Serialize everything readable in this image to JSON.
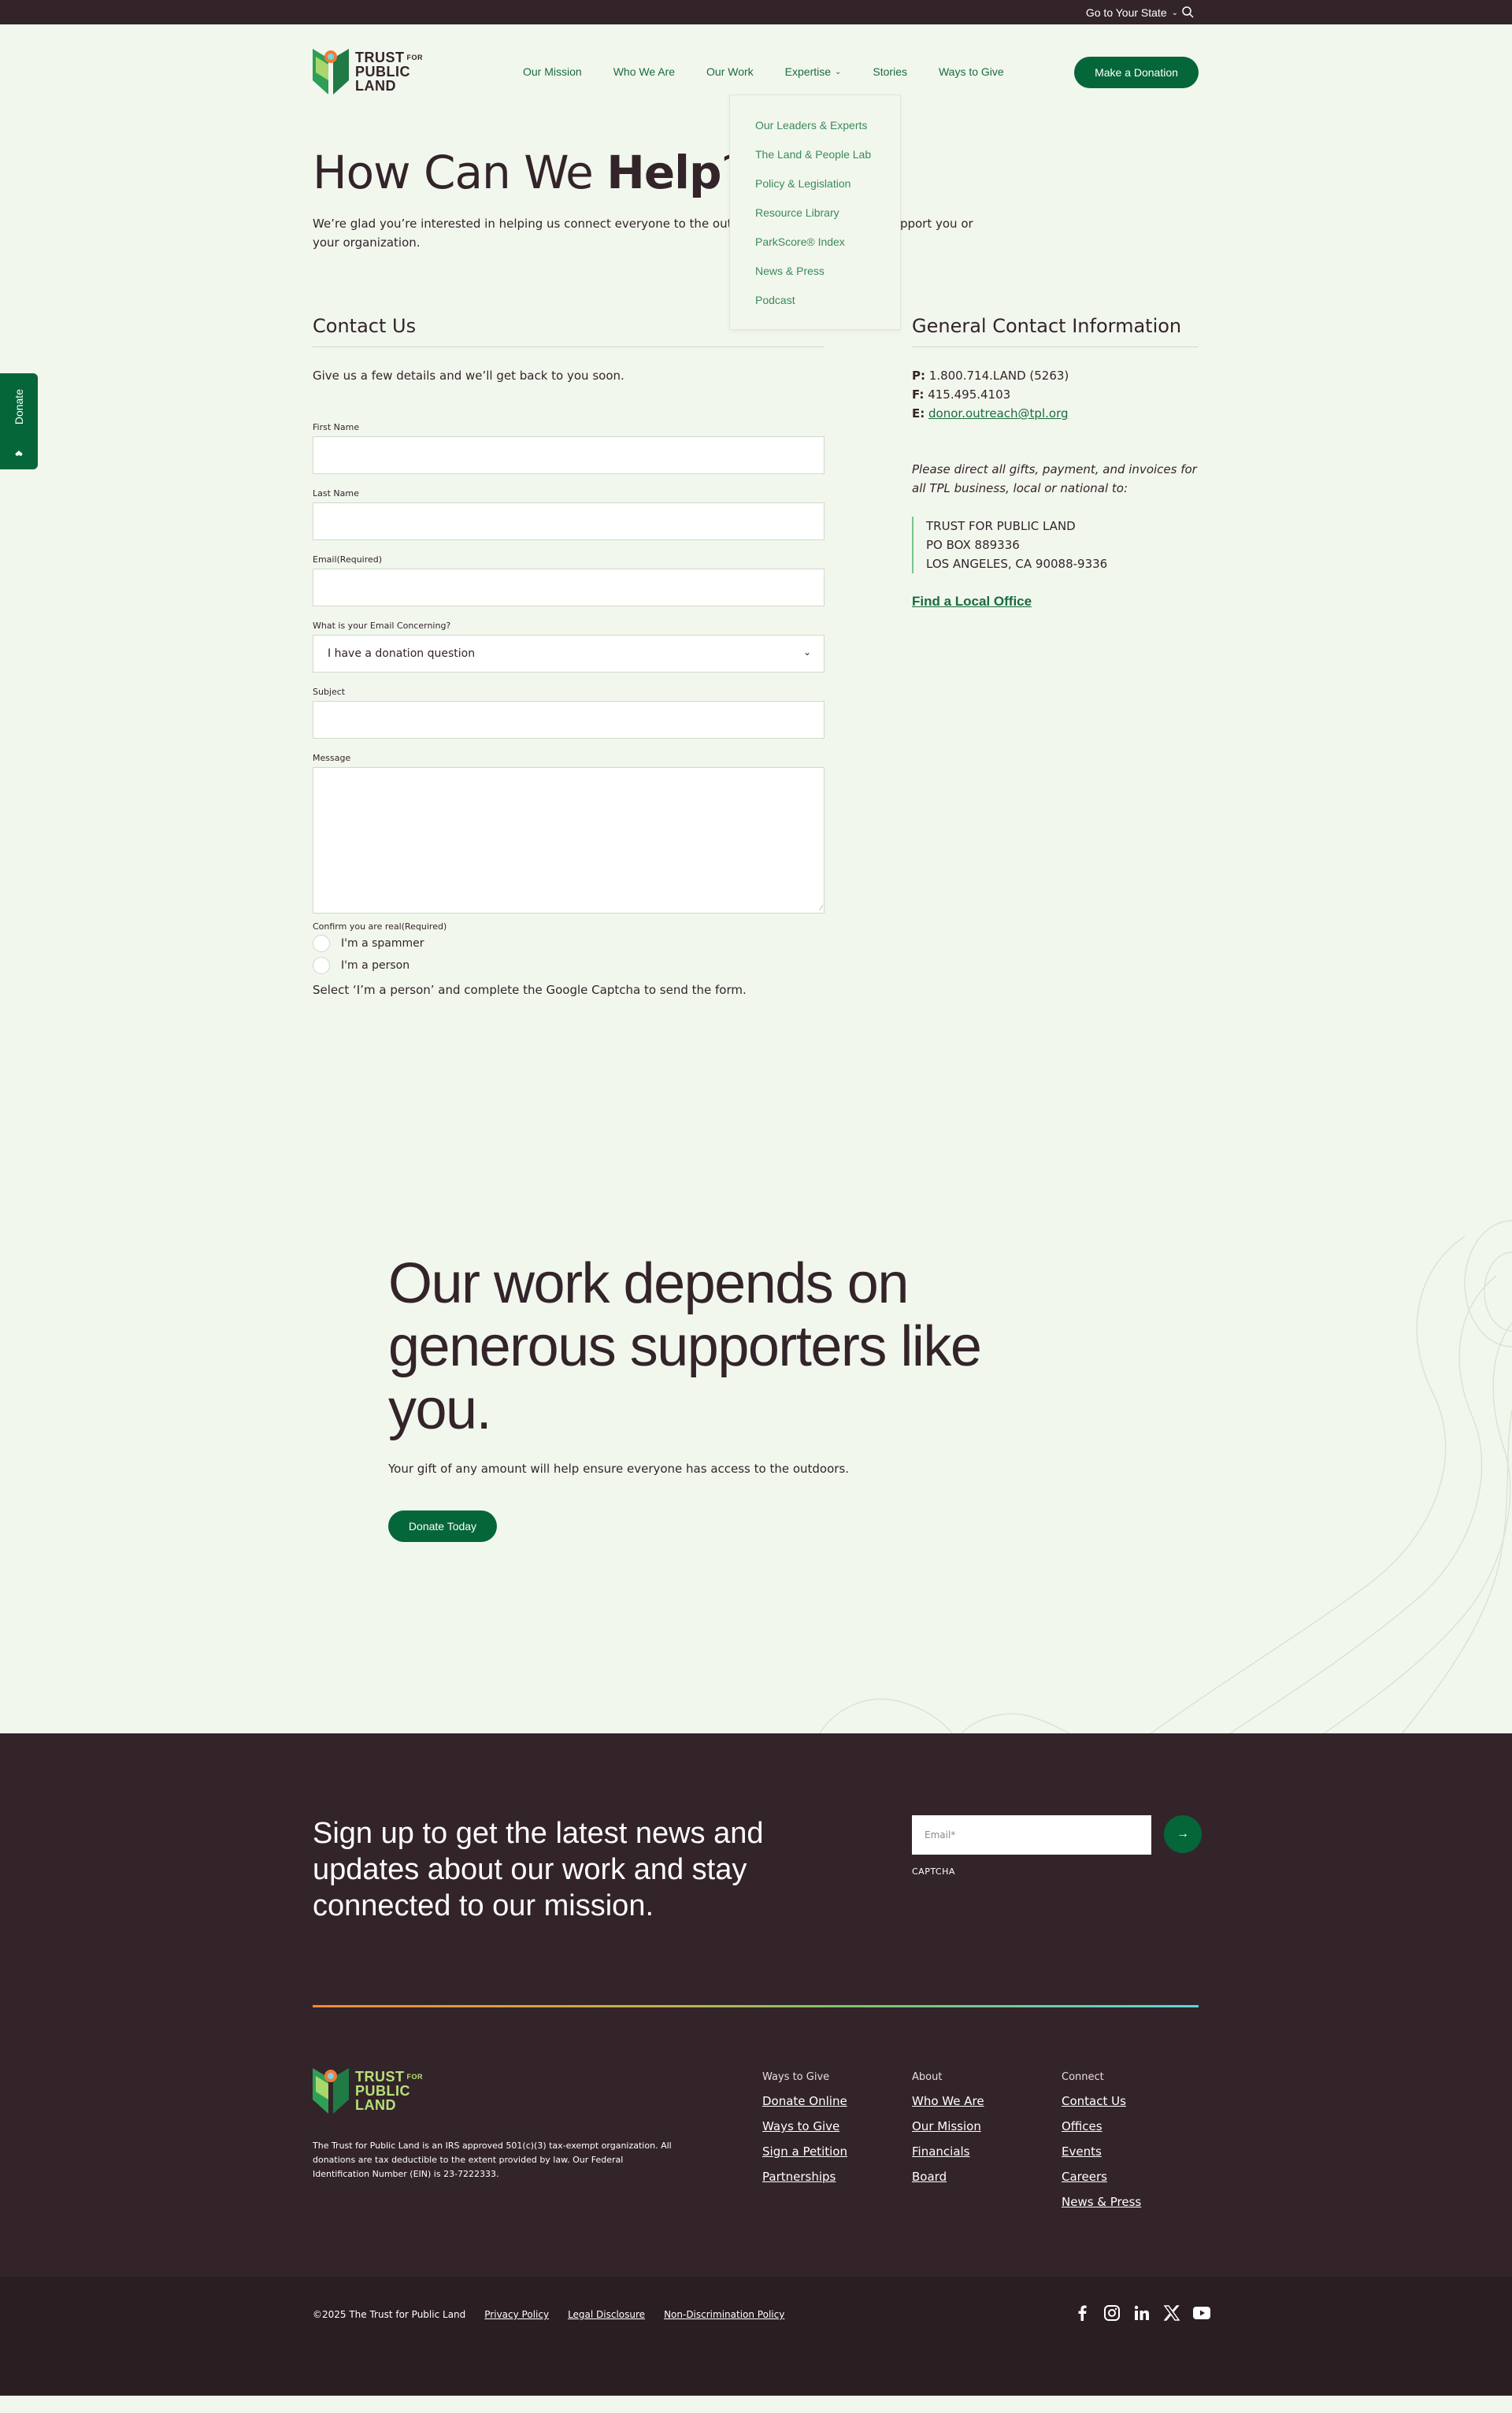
{
  "topbar": {
    "state_label": "Go to Your State"
  },
  "header": {
    "logo_line1": "TRUST",
    "logo_for": "FOR",
    "logo_line2": "PUBLIC",
    "logo_line3": "LAND",
    "nav": [
      "Our Mission",
      "Who We Are",
      "Our Work",
      "Expertise",
      "Stories",
      "Ways to Give"
    ],
    "donate_label": "Make a Donation"
  },
  "dropdown": [
    "Our Leaders & Experts",
    "The Land & People Lab",
    "Policy & Legislation",
    "Resource Library",
    "ParkScore® Index",
    "News & Press",
    "Podcast"
  ],
  "side_donate": "Donate",
  "page": {
    "title_plain": "How Can We ",
    "title_bold": "Help",
    "title_end": "?",
    "intro": "We’re glad you’re interested in helping us connect everyone to the outdoors. Tell us how we can support you or your organization."
  },
  "form": {
    "heading": "Contact Us",
    "subtitle": "Give us a few details and we’ll get back to you soon.",
    "first_name": "First Name",
    "last_name": "Last Name",
    "email": "Email(Required)",
    "concern_label": "What is your Email Concerning?",
    "concern_value": "I have a donation question",
    "subject": "Subject",
    "message": "Message",
    "confirm": "Confirm you are real(Required)",
    "radio_spammer": "I'm a spammer",
    "radio_person": "I'm a person",
    "captcha_note": "Select ‘I’m a person’ and complete the Google Captcha to send the form."
  },
  "contact": {
    "heading": "General Contact Information",
    "phone_label": "P:",
    "phone": "1.800.714.LAND (5263)",
    "fax_label": "F:",
    "fax": "415.495.4103",
    "email_label": "E:",
    "email": "donor.outreach@tpl.org",
    "note": "Please direct all gifts, payment, and invoices for all TPL business, local or national to:",
    "addr1": "TRUST FOR PUBLIC LAND",
    "addr2": "PO BOX 889336",
    "addr3": "LOS ANGELES, CA 90088-9336",
    "local": "Find a Local Office"
  },
  "support": {
    "heading": "Our work depends on generous supporters like you.",
    "text": "Your gift of any amount will help ensure everyone has access to the outdoors.",
    "button": "Donate Today"
  },
  "footer": {
    "signup": "Sign up to get the latest news and updates about our work and stay connected to our mission.",
    "email_placeholder": "Email*",
    "captcha": "CAPTCHA",
    "description": "The Trust for Public Land is an IRS approved 501(c)(3) tax-exempt organization. All donations are tax deductible to the extent provided by law. Our Federal Identification Number (EIN) is 23-7222333.",
    "cols": [
      {
        "heading": "Ways to Give",
        "links": [
          "Donate Online",
          "Ways to Give",
          "Sign a Petition",
          "Partnerships"
        ]
      },
      {
        "heading": "About",
        "links": [
          "Who We Are",
          "Our Mission",
          "Financials",
          "Board"
        ]
      },
      {
        "heading": "Connect",
        "links": [
          "Contact Us",
          "Offices",
          "Events",
          "Careers",
          "News & Press"
        ]
      }
    ]
  },
  "bottom": {
    "copyright": "©2025 The Trust for Public Land",
    "links": [
      "Privacy Policy",
      "Legal Disclosure",
      "Non-Discrimination Policy"
    ],
    "social": [
      "facebook-icon",
      "instagram-icon",
      "linkedin-icon",
      "x-icon",
      "youtube-icon"
    ]
  },
  "colors": {
    "brand_green": "#05663a",
    "dark": "#33242a",
    "page_bg": "#f2f7ee"
  }
}
